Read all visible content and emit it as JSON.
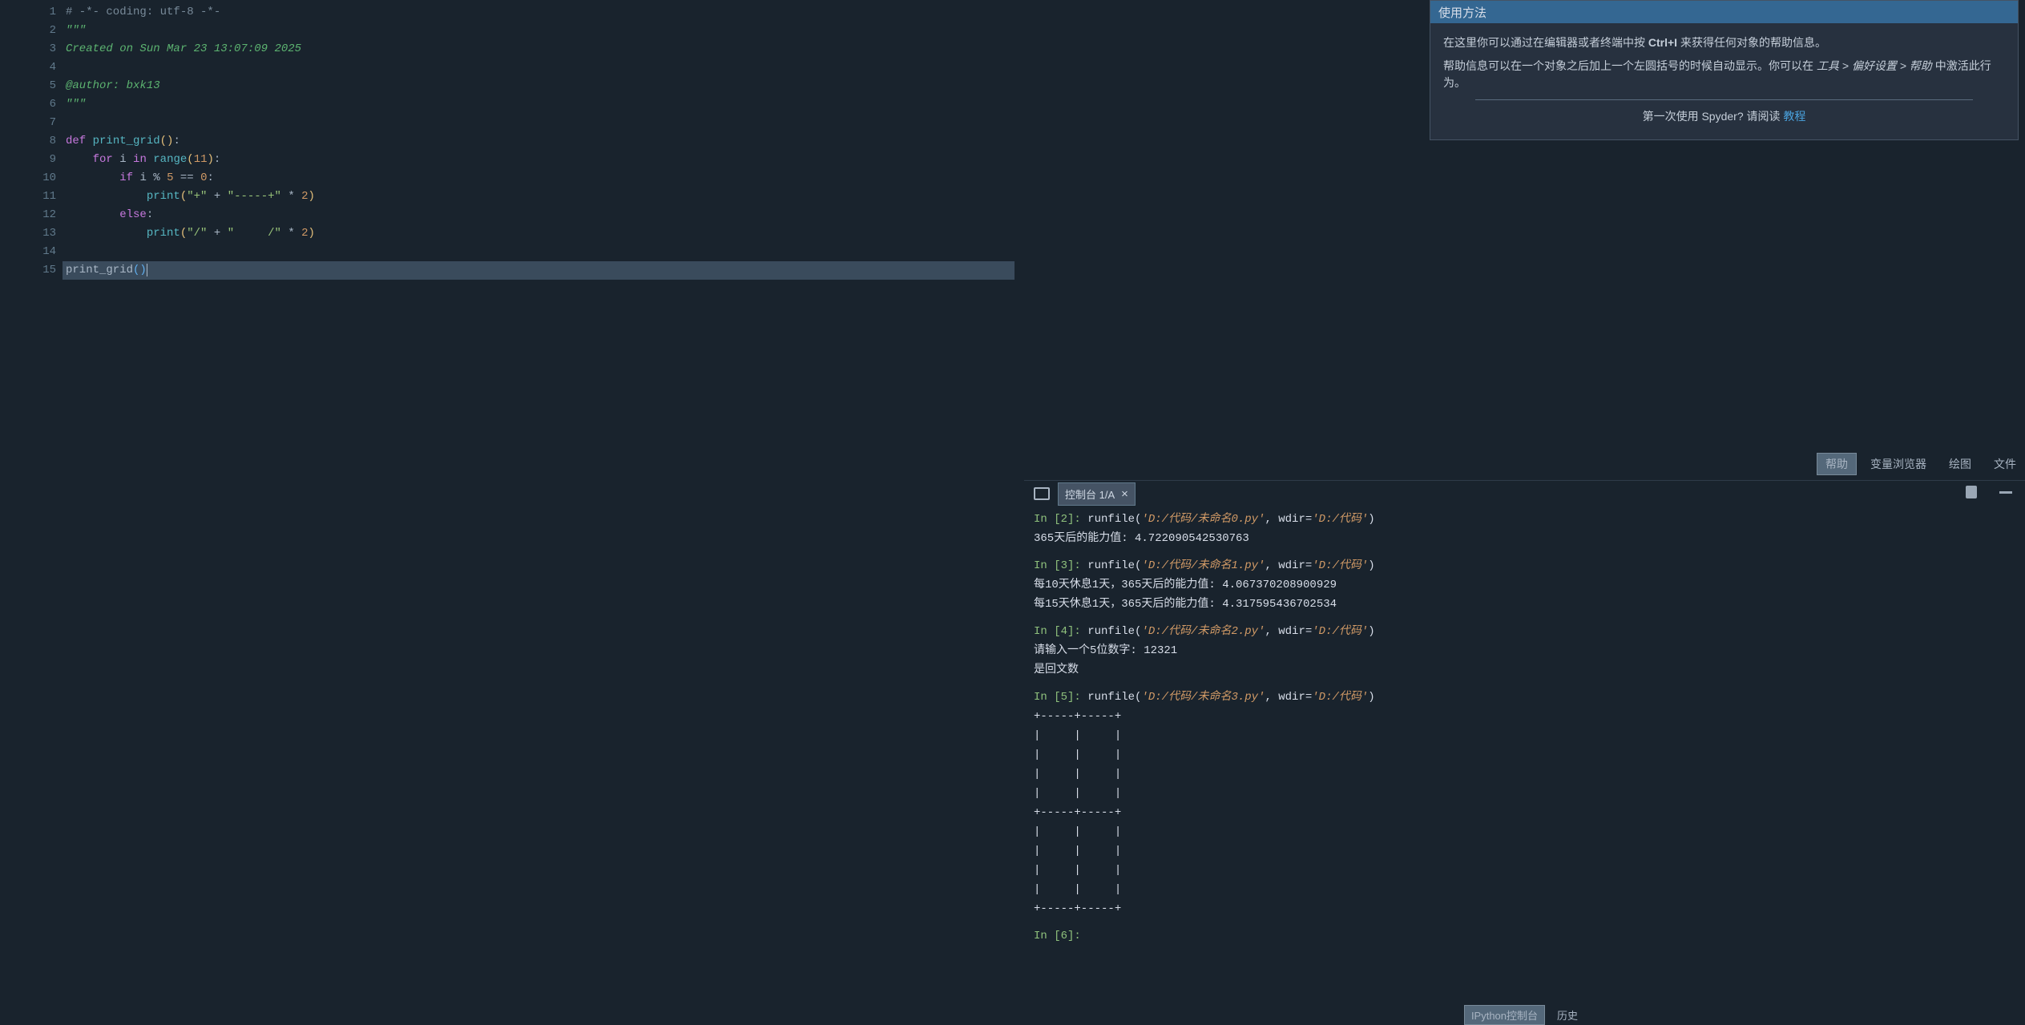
{
  "editor": {
    "line_numbers": [
      "1",
      "2",
      "3",
      "4",
      "5",
      "6",
      "7",
      "8",
      "9",
      "10",
      "11",
      "12",
      "13",
      "14",
      "15"
    ],
    "lines_html": [
      "<span class='c-gray'># -*- coding: utf-8 -*-</span>",
      "<span class='c-str'>\"\"\"</span>",
      "<span class='c-str'>Created on Sun Mar 23 13:07:09 2025</span>",
      "",
      "<span class='c-str'>@author: bxk13</span>",
      "<span class='c-str'>\"\"\"</span>",
      "",
      "<span class='c-kw'>def</span> <span class='c-fn'>print_grid</span><span class='c-par'>()</span><span class='c-op'>:</span>",
      "    <span class='c-kw'>for</span> <span class='c-id'>i</span> <span class='c-kw'>in</span> <span class='c-bi'>range</span><span class='c-par'>(</span><span class='c-num'>11</span><span class='c-par'>)</span><span class='c-op'>:</span>",
      "        <span class='c-kw'>if</span> <span class='c-id'>i</span> <span class='c-op'>%</span> <span class='c-num'>5</span> <span class='c-op'>==</span> <span class='c-num'>0</span><span class='c-op'>:</span>",
      "            <span class='c-bi'>print</span><span class='c-par'>(</span><span class='c-lit'>\"+\"</span> <span class='c-op'>+</span> <span class='c-lit'>\"-----+\"</span> <span class='c-op'>*</span> <span class='c-num'>2</span><span class='c-par'>)</span>",
      "        <span class='c-kw'>else</span><span class='c-op'>:</span>",
      "            <span class='c-bi'>print</span><span class='c-par'>(</span><span class='c-lit'>\"/\"</span> <span class='c-op'>+</span> <span class='c-lit'>\"     /\"</span> <span class='c-op'>*</span> <span class='c-num'>2</span><span class='c-par'>)</span>",
      "",
      "<span class='c-id'>print_grid</span><span class='c-par2'>(</span><span class='c-par2 cursor'>)</span>"
    ],
    "highlight_line_index": 14
  },
  "help": {
    "title": "使用方法",
    "p1_a": "在这里你可以通过在编辑器或者终端中按 ",
    "p1_kbd": "Ctrl+I",
    "p1_b": " 来获得任何对象的帮助信息。",
    "p2_a": "帮助信息可以在一个对象之后加上一个左圆括号的时候自动显示。你可以在 ",
    "p2_em": "工具 > 偏好设置 > 帮助",
    "p2_b": " 中激活此行为。",
    "footer_a": "第一次使用 Spyder? 请阅读 ",
    "footer_link": "教程"
  },
  "pane_tabs": {
    "items": [
      "帮助",
      "变量浏览器",
      "绘图",
      "文件"
    ],
    "active": 0
  },
  "console": {
    "tab_label": "控制台 1/A",
    "blocks": [
      {
        "prompt": "In [2]:",
        "cmd_pre": " runfile(",
        "path1": "'D:/代码/未命名0.py'",
        "cmd_mid": ", wdir=",
        "path2": "'D:/代码'",
        "cmd_post": ")",
        "out": [
          "365天后的能力值: 4.722090542530763"
        ]
      },
      {
        "prompt": "In [3]:",
        "cmd_pre": " runfile(",
        "path1": "'D:/代码/未命名1.py'",
        "cmd_mid": ", wdir=",
        "path2": "'D:/代码'",
        "cmd_post": ")",
        "out": [
          "每10天休息1天，365天后的能力值: 4.067370208900929",
          "每15天休息1天，365天后的能力值: 4.317595436702534"
        ]
      },
      {
        "prompt": "In [4]:",
        "cmd_pre": " runfile(",
        "path1": "'D:/代码/未命名2.py'",
        "cmd_mid": ", wdir=",
        "path2": "'D:/代码'",
        "cmd_post": ")",
        "out": [
          "请输入一个5位数字: 12321",
          "是回文数"
        ]
      },
      {
        "prompt": "In [5]:",
        "cmd_pre": " runfile(",
        "path1": "'D:/代码/未命名3.py'",
        "cmd_mid": ", wdir=",
        "path2": "'D:/代码'",
        "cmd_post": ")",
        "out": [
          "+-----+-----+",
          "|     |     |",
          "|     |     |",
          "|     |     |",
          "|     |     |",
          "+-----+-----+",
          "|     |     |",
          "|     |     |",
          "|     |     |",
          "|     |     |",
          "+-----+-----+"
        ]
      }
    ],
    "next_prompt": "In [6]:",
    "bottom_tabs": [
      "IPython控制台",
      "历史"
    ],
    "bottom_active": 0
  }
}
